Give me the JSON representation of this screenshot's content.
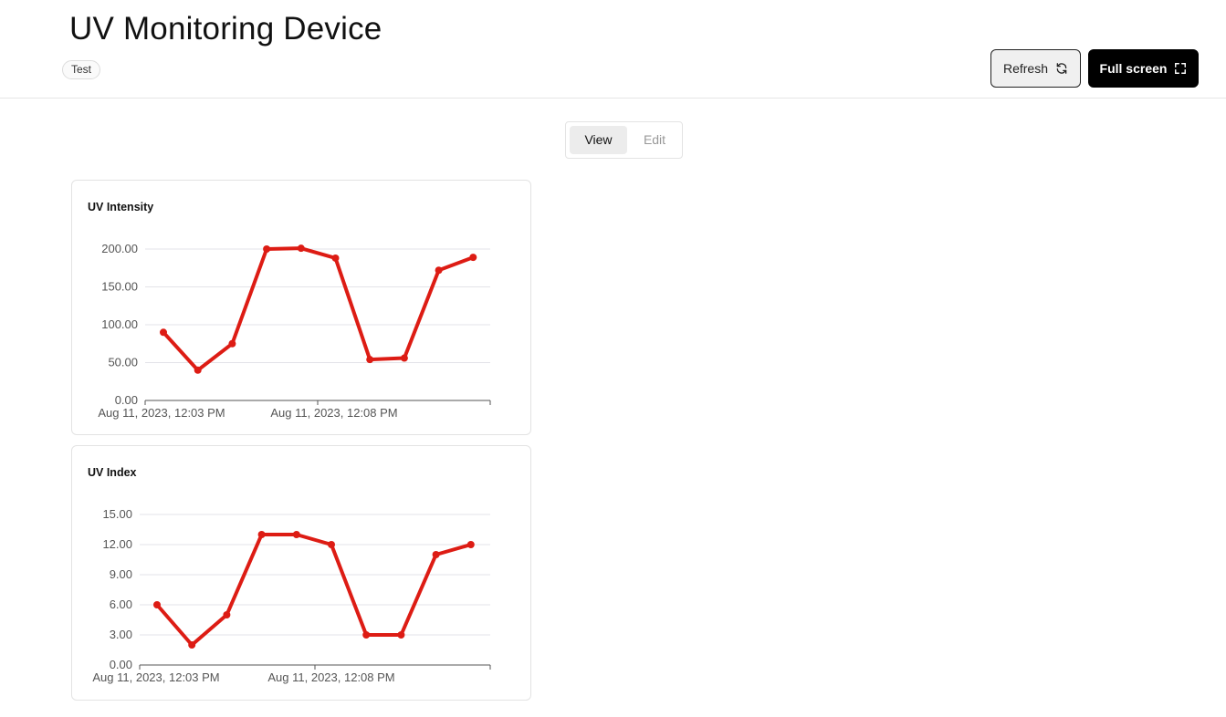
{
  "header": {
    "title": "UV Monitoring Device",
    "tag": "Test",
    "refresh_label": "Refresh",
    "fullscreen_label": "Full screen"
  },
  "mode_toggle": {
    "view_label": "View",
    "edit_label": "Edit",
    "selected": "View"
  },
  "colors": {
    "series": "#dd1c14",
    "primary_button": "#000000"
  },
  "icons": {
    "refresh": "refresh-icon",
    "fullscreen": "fullscreen-icon"
  },
  "chart_data": [
    {
      "type": "line",
      "title": "UV Intensity",
      "x": [
        "12:03",
        "12:04",
        "12:05",
        "12:06",
        "12:07",
        "12:08",
        "12:09",
        "12:10",
        "12:11",
        "12:12"
      ],
      "x_tick_labels": [
        "Aug 11, 2023, 12:03 PM",
        "Aug 11, 2023, 12:08 PM"
      ],
      "values": [
        90,
        40,
        75,
        200,
        201,
        188,
        54,
        56,
        172,
        189
      ],
      "ylim": [
        0,
        200
      ],
      "y_ticks": [
        "0.00",
        "50.00",
        "100.00",
        "150.00",
        "200.00"
      ],
      "grid": true,
      "legend": "none"
    },
    {
      "type": "line",
      "title": "UV Index",
      "x": [
        "12:03",
        "12:04",
        "12:05",
        "12:06",
        "12:07",
        "12:08",
        "12:09",
        "12:10",
        "12:11",
        "12:12"
      ],
      "x_tick_labels": [
        "Aug 11, 2023, 12:03 PM",
        "Aug 11, 2023, 12:08 PM"
      ],
      "values": [
        6,
        2,
        5,
        13,
        13,
        12,
        3,
        3,
        11,
        12
      ],
      "ylim": [
        0,
        15
      ],
      "y_ticks": [
        "0.00",
        "3.00",
        "6.00",
        "9.00",
        "12.00",
        "15.00"
      ],
      "grid": true,
      "legend": "none"
    }
  ]
}
